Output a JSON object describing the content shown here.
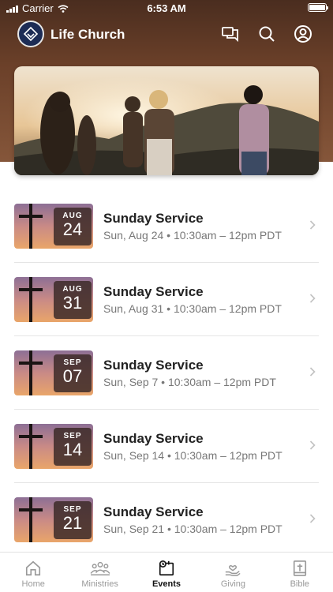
{
  "status_bar": {
    "carrier": "Carrier",
    "time": "6:53 AM"
  },
  "app": {
    "title": "Life Church"
  },
  "header_icons": [
    "chat-icon",
    "search-icon",
    "profile-icon"
  ],
  "events": [
    {
      "month": "AUG",
      "day": "24",
      "title": "Sunday Service",
      "subtitle": "Sun, Aug 24 • 10:30am – 12pm PDT"
    },
    {
      "month": "AUG",
      "day": "31",
      "title": "Sunday Service",
      "subtitle": "Sun, Aug 31 • 10:30am – 12pm PDT"
    },
    {
      "month": "SEP",
      "day": "07",
      "title": "Sunday Service",
      "subtitle": "Sun, Sep 7 • 10:30am – 12pm PDT"
    },
    {
      "month": "SEP",
      "day": "14",
      "title": "Sunday Service",
      "subtitle": "Sun, Sep 14 • 10:30am – 12pm PDT"
    },
    {
      "month": "SEP",
      "day": "21",
      "title": "Sunday Service",
      "subtitle": "Sun, Sep 21 • 10:30am – 12pm PDT"
    }
  ],
  "tabs": [
    {
      "label": "Home",
      "icon": "home-icon",
      "active": false
    },
    {
      "label": "Ministries",
      "icon": "ministries-icon",
      "active": false
    },
    {
      "label": "Events",
      "icon": "events-icon",
      "active": true
    },
    {
      "label": "Giving",
      "icon": "giving-icon",
      "active": false
    },
    {
      "label": "Bible",
      "icon": "bible-icon",
      "active": false
    }
  ],
  "colors": {
    "header": "#6b4029",
    "active_tab": "#111111",
    "inactive_tab": "#999999"
  }
}
